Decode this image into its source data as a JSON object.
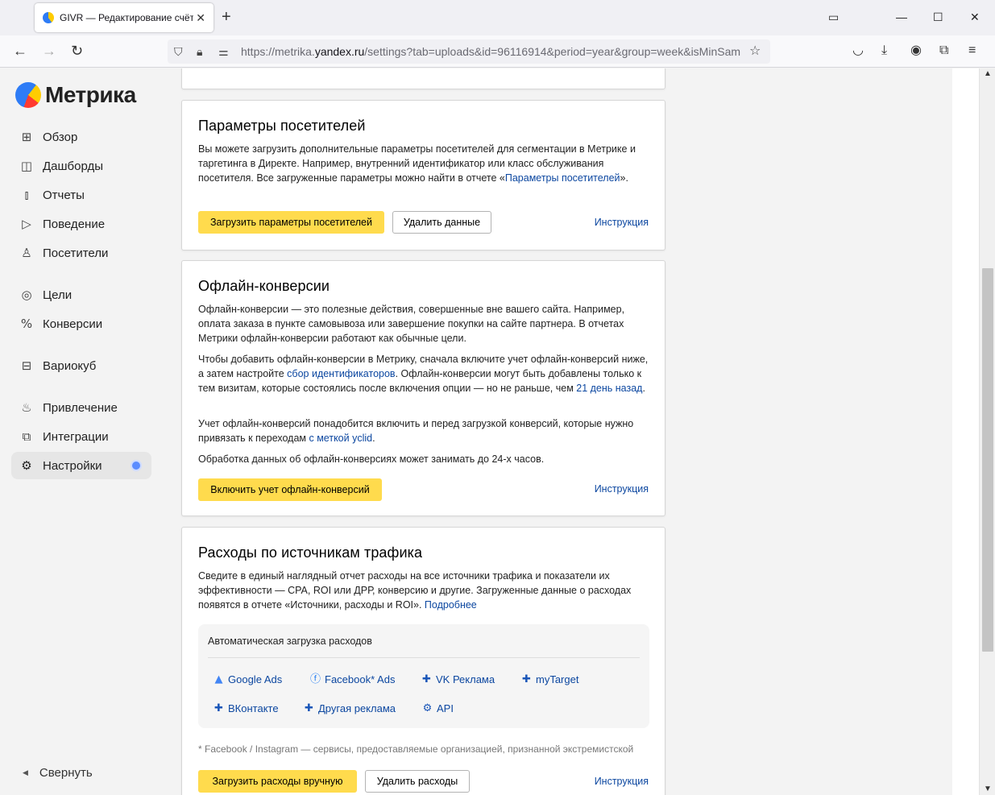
{
  "browser": {
    "tab_title": "GIVR — Редактирование счётч",
    "new_tab": "+",
    "url_host": "https://metrika.yandex.ru",
    "url_prefix": "https://metrika.",
    "url_domain": "yandex.ru",
    "url_path": "/settings?tab=uploads&id=96116914&period=year&group=week&isMinSam",
    "icons": [
      "back-icon",
      "forward-icon",
      "reload-icon",
      "shield-icon",
      "lock-icon",
      "permissions-icon",
      "bookmark-star-icon",
      "pocket-icon",
      "download-icon",
      "account-icon",
      "extensions-icon",
      "menu-icon"
    ]
  },
  "sidebar": {
    "logo_text": "Метрика",
    "items": [
      {
        "label": "Обзор",
        "icon": "grid-icon"
      },
      {
        "label": "Дашборды",
        "icon": "dashboards-icon"
      },
      {
        "label": "Отчеты",
        "icon": "reports-icon"
      },
      {
        "label": "Поведение",
        "icon": "play-icon"
      },
      {
        "label": "Посетители",
        "icon": "user-icon"
      },
      {
        "label": "Цели",
        "icon": "target-icon"
      },
      {
        "label": "Конверсии",
        "icon": "percent-icon"
      },
      {
        "label": "Вариокуб",
        "icon": "cube-icon"
      },
      {
        "label": "Привлечение",
        "icon": "fire-icon"
      },
      {
        "label": "Интеграции",
        "icon": "integrations-icon"
      },
      {
        "label": "Настройки",
        "icon": "gear-icon"
      }
    ],
    "collapse_label": "Свернуть"
  },
  "visitor_params": {
    "title": "Параметры посетителей",
    "text": "Вы можете загрузить дополнительные параметры посетителей для сегментации в Метрике и таргетинга в Директе. Например, внутренний идентификатор или класс обслуживания посетителя. Все загруженные параметры можно найти в отчете «",
    "link": "Параметры посетителей",
    "text_end": "».",
    "upload_button": "Загрузить параметры посетителей",
    "delete_button": "Удалить данные",
    "instruction": "Инструкция"
  },
  "offline_conv": {
    "title": "Офлайн-конверсии",
    "p1": "Офлайн-конверсии — это полезные действия, совершенные вне вашего сайта. Например, оплата заказа в пункте самовывоза или завершение покупки на сайте партнера. В отчетах Метрики офлайн-конверсии работают как обычные цели.",
    "p2_a": "Чтобы добавить офлайн-конверсии в Метрику, сначала включите учет офлайн-конверсий ниже, а затем настройте ",
    "p2_link1": "сбор идентификаторов",
    "p2_b": ". Офлайн-конверсии могут быть добавлены только к тем визитам, которые состоялись после включения опции — но не раньше, чем ",
    "p2_link2": "21 день назад",
    "p2_c": ".",
    "p3_a": "Учет офлайн-конверсий понадобится включить и перед загрузкой конверсий, которые нужно привязать к переходам ",
    "p3_link": "с меткой yclid",
    "p3_b": ".",
    "p4": "Обработка данных об офлайн-конверсиях может занимать до 24-х часов.",
    "enable_button": "Включить учет офлайн-конверсий",
    "instruction": "Инструкция"
  },
  "expenses": {
    "title": "Расходы по источникам трафика",
    "text": "Сведите в единый наглядный отчет расходы на все источники трафика и показатели их эффективности — CPA, ROI или ДРР, конверсию и другие. Загруженные данные о расходах появятся в отчете «Источники, расходы и ROI». ",
    "more_link": "Подробнее",
    "auto_title": "Автоматическая загрузка расходов",
    "sources": [
      {
        "label": "Google Ads",
        "icon": "google-ads-icon"
      },
      {
        "label": "Facebook* Ads",
        "icon": "facebook-icon"
      },
      {
        "label": "VK Реклама",
        "icon": "puzzle-icon"
      },
      {
        "label": "myTarget",
        "icon": "puzzle-icon"
      },
      {
        "label": "ВКонтакте",
        "icon": "puzzle-icon"
      },
      {
        "label": "Другая реклама",
        "icon": "puzzle-icon"
      },
      {
        "label": "API",
        "icon": "gear-icon"
      }
    ],
    "footnote": "* Facebook / Instagram — сервисы, предоставляемые организацией, признанной экстремистской",
    "upload_button": "Загрузить расходы вручную",
    "delete_button": "Удалить расходы",
    "instruction": "Инструкция"
  },
  "colors": {
    "accent_yellow": "#ffdb4d",
    "link_blue": "#0c47a0",
    "active_dot": "#5b8cff"
  }
}
